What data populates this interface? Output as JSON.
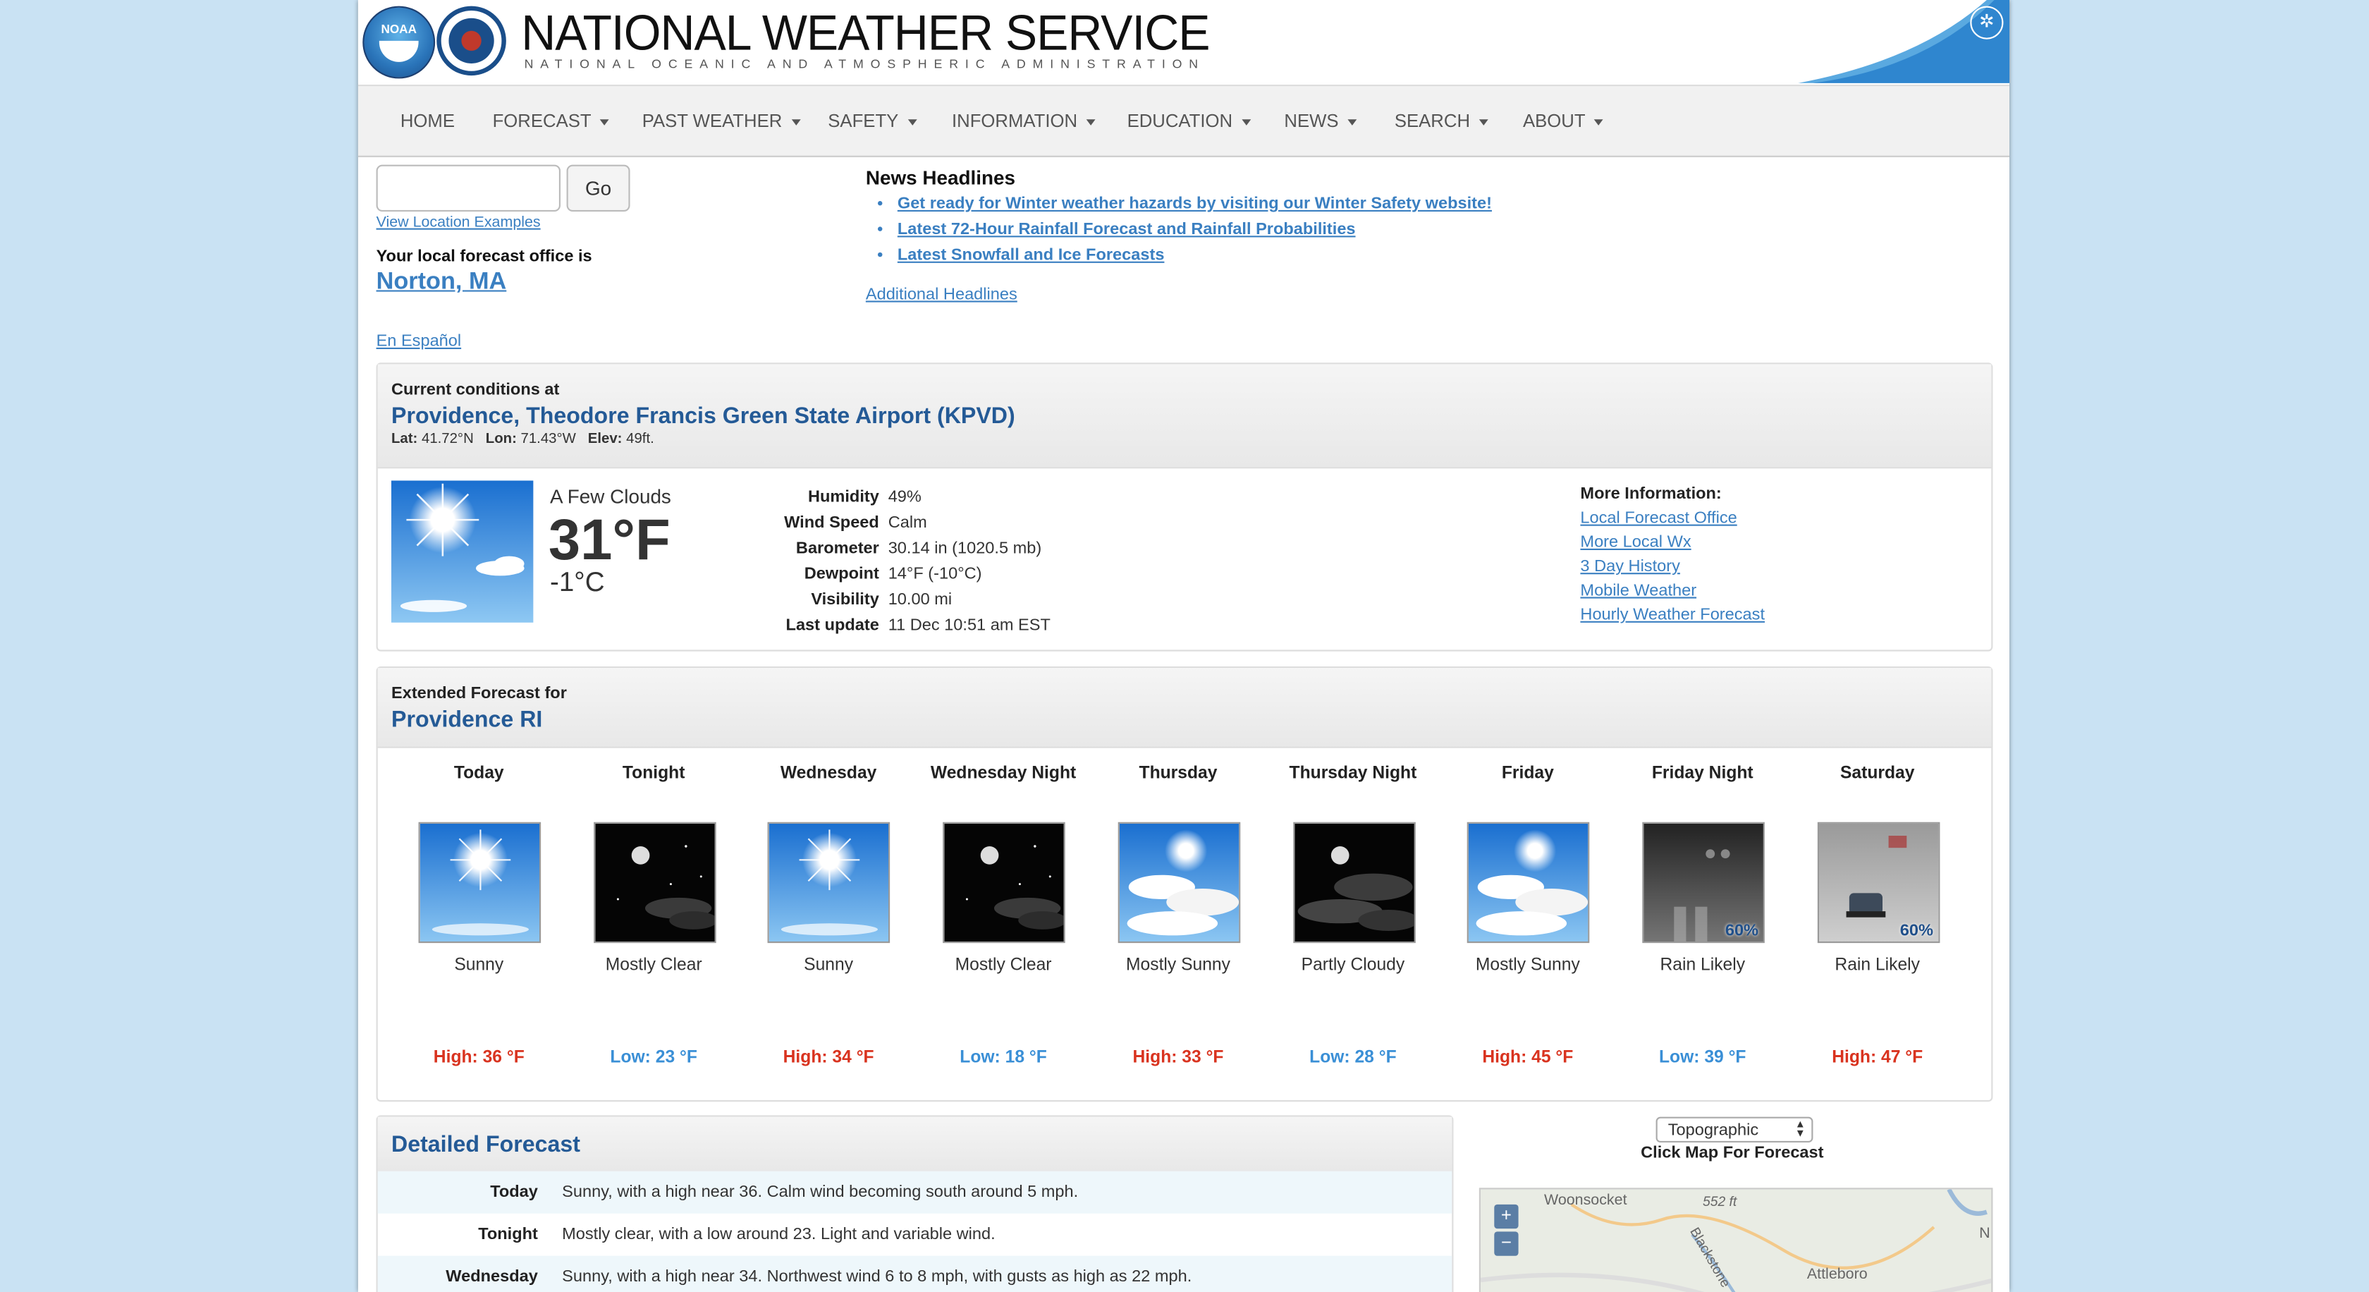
{
  "header": {
    "title": "NATIONAL WEATHER SERVICE",
    "subtitle": "NATIONAL OCEANIC AND ATMOSPHERIC ADMINISTRATION",
    "noaa_logo_text": "NOAA"
  },
  "nav": {
    "home": "HOME",
    "forecast": "FORECAST",
    "past_weather": "PAST WEATHER",
    "safety": "SAFETY",
    "information": "INFORMATION",
    "education": "EDUCATION",
    "news": "NEWS",
    "search": "SEARCH",
    "about": "ABOUT"
  },
  "search": {
    "value": "",
    "go_label": "Go",
    "view_examples": "View Location Examples"
  },
  "office": {
    "label": "Your local forecast office is",
    "name": "Norton, MA"
  },
  "espanol": "En Español",
  "news": {
    "title": "News Headlines",
    "items": [
      "Get ready for Winter weather hazards by visiting our Winter Safety website!",
      "Latest 72-Hour Rainfall Forecast and Rainfall Probabilities",
      "Latest Snowfall and Ice Forecasts"
    ],
    "additional": "Additional Headlines"
  },
  "current": {
    "heading": "Current conditions at",
    "station": "Providence, Theodore Francis Green State Airport (KPVD)",
    "lat_label": "Lat:",
    "lat": "41.72°N",
    "lon_label": "Lon:",
    "lon": "71.43°W",
    "elev_label": "Elev:",
    "elev": "49ft.",
    "summary": "A Few Clouds",
    "temp_f": "31°F",
    "temp_c": "-1°C",
    "rows": [
      {
        "label": "Humidity",
        "value": "49%"
      },
      {
        "label": "Wind Speed",
        "value": "Calm"
      },
      {
        "label": "Barometer",
        "value": "30.14 in (1020.5 mb)"
      },
      {
        "label": "Dewpoint",
        "value": "14°F (-10°C)"
      },
      {
        "label": "Visibility",
        "value": "10.00 mi"
      },
      {
        "label": "Last update",
        "value": "11 Dec 10:51 am EST"
      }
    ],
    "more_info_title": "More Information:",
    "more_info_links": [
      "Local Forecast Office",
      "More Local Wx",
      "3 Day History",
      "Mobile Weather",
      "Hourly Weather Forecast"
    ]
  },
  "extended": {
    "heading": "Extended Forecast for",
    "location": "Providence RI",
    "periods": [
      {
        "name": "Today",
        "icon": "sunny",
        "desc": "Sunny",
        "temp": "High: 36 °F",
        "type": "high",
        "pop": ""
      },
      {
        "name": "Tonight",
        "icon": "night-clear",
        "desc": "Mostly Clear",
        "temp": "Low: 23 °F",
        "type": "low",
        "pop": ""
      },
      {
        "name": "Wednesday",
        "icon": "sunny",
        "desc": "Sunny",
        "temp": "High: 34 °F",
        "type": "high",
        "pop": ""
      },
      {
        "name": "Wednesday Night",
        "icon": "night-clear",
        "desc": "Mostly Clear",
        "temp": "Low: 18 °F",
        "type": "low",
        "pop": ""
      },
      {
        "name": "Thursday",
        "icon": "mostly-sunny",
        "desc": "Mostly Sunny",
        "temp": "High: 33 °F",
        "type": "high",
        "pop": ""
      },
      {
        "name": "Thursday Night",
        "icon": "night-partly-cloudy",
        "desc": "Partly Cloudy",
        "temp": "Low: 28 °F",
        "type": "low",
        "pop": ""
      },
      {
        "name": "Friday",
        "icon": "mostly-sunny",
        "desc": "Mostly Sunny",
        "temp": "High: 45 °F",
        "type": "high",
        "pop": ""
      },
      {
        "name": "Friday Night",
        "icon": "rain-night",
        "desc": "Rain Likely",
        "temp": "Low: 39 °F",
        "type": "low",
        "pop": "60%"
      },
      {
        "name": "Saturday",
        "icon": "rain-day",
        "desc": "Rain Likely",
        "temp": "High: 47 °F",
        "type": "high",
        "pop": "60%"
      }
    ]
  },
  "detailed": {
    "title": "Detailed Forecast",
    "rows": [
      {
        "label": "Today",
        "text": "Sunny, with a high near 36. Calm wind becoming south around 5 mph."
      },
      {
        "label": "Tonight",
        "text": "Mostly clear, with a low around 23. Light and variable wind."
      },
      {
        "label": "Wednesday",
        "text": "Sunny, with a high near 34. Northwest wind 6 to 8 mph, with gusts as high as 22 mph."
      }
    ]
  },
  "map": {
    "select_value": "Topographic",
    "click_label": "Click Map For Forecast",
    "zoom_in": "+",
    "zoom_out": "−",
    "labels": [
      "Woonsocket",
      "552 ft",
      "Blackstone",
      "Attleboro",
      "N"
    ]
  },
  "colors": {
    "high": "#d9331f",
    "low": "#3a8fd6",
    "link": "#3a7fc1",
    "heading_blue": "#245a96",
    "page_bg": "#c9e2f3"
  }
}
